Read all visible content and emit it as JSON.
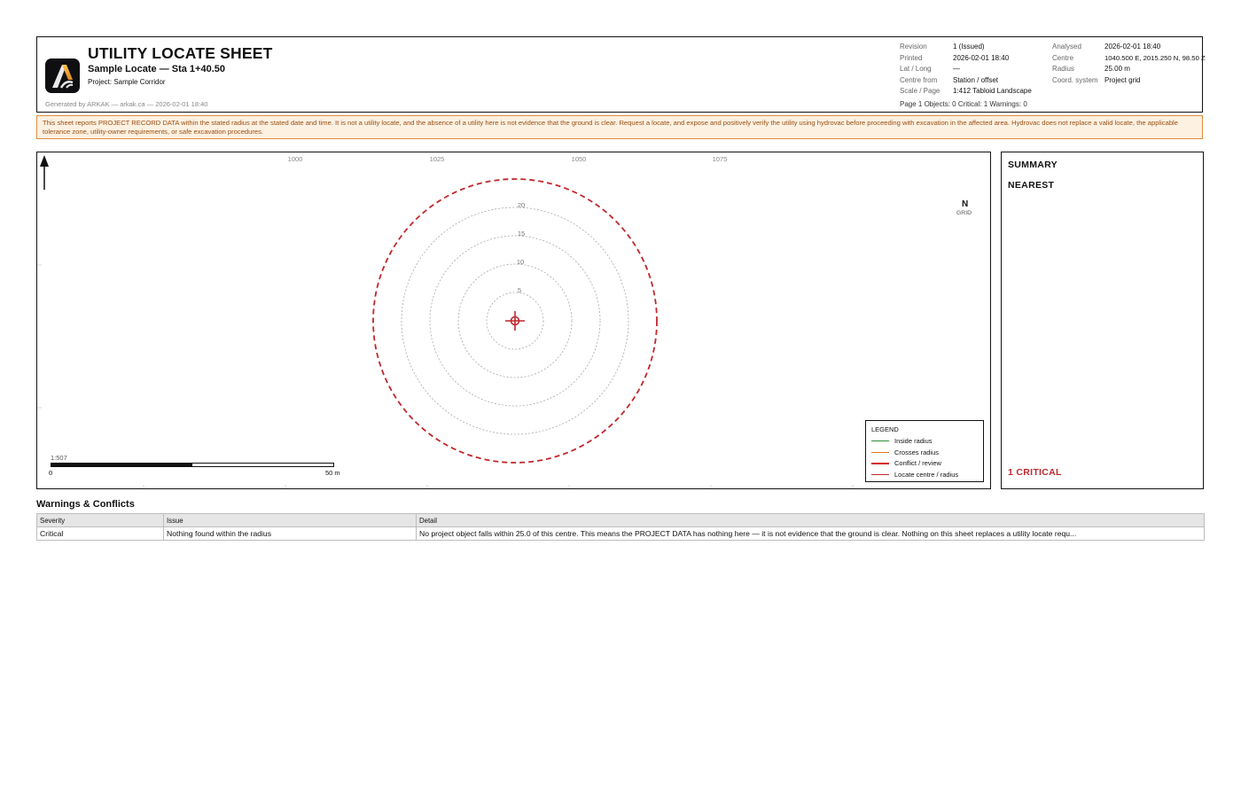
{
  "header": {
    "title": "UTILITY LOCATE SHEET",
    "subtitle": "Sample Locate — Sta 1+40.50",
    "project": "Project: Sample Corridor",
    "generated": "Generated by ARKAK — arkak.ca — 2026-02-01 18:40",
    "logo_icon": "arkak-logo-icon",
    "meta_left": [
      {
        "key": "Revision",
        "value": "1  (Issued)"
      },
      {
        "key": "Printed",
        "value": "2026-02-01 18:40"
      },
      {
        "key": "Lat / Long",
        "value": "—"
      },
      {
        "key": "Centre from",
        "value": "Station / offset"
      },
      {
        "key": "Scale / Page",
        "value": "1:412  Tabloid Landscape"
      }
    ],
    "meta_right": [
      {
        "key": "Analysed",
        "value": "2026-02-01 18:40"
      },
      {
        "key": "Centre",
        "value": "1040.500 E, 2015.250 N, 98.50 Z"
      },
      {
        "key": "Radius",
        "value": "25.00 m"
      },
      {
        "key": "Coord. system",
        "value": "Project grid"
      }
    ],
    "counts": "Page 1    Objects: 0    Critical: 1    Warnings: 0"
  },
  "disclaimer": "This sheet reports PROJECT RECORD DATA within the stated radius at the stated date and time. It is not a utility locate, and the absence of a utility here is not evidence that the ground is clear. Request a locate, and expose and positively verify the utility using hydrovac before proceeding with excavation in the affected area. Hydrovac does not replace a valid locate, the applicable tolerance zone, utility-owner requirements, or safe excavation procedures.",
  "map": {
    "grid_labels": [
      "1000",
      "1025",
      "1050",
      "1075"
    ],
    "ring_labels": [
      "5",
      "10",
      "15",
      "20"
    ],
    "north_label": "N",
    "north_sub": "GRID",
    "north_icon": "north-arrow-icon",
    "centre_icon": "crosshair-icon",
    "scale_ratio": "1:507",
    "scale_start": "0",
    "scale_end": "50 m",
    "legend": {
      "title": "LEGEND",
      "items": [
        {
          "label": "Inside radius",
          "color": "#2e8b3a"
        },
        {
          "label": "Crosses radius",
          "color": "#e07a1f"
        },
        {
          "label": "Conflict / review",
          "color": "#d42020"
        },
        {
          "label": "Locate centre / radius",
          "color": "#c0272d"
        }
      ]
    }
  },
  "summary": {
    "heading": "SUMMARY",
    "nearest_heading": "NEAREST",
    "critical": "1 CRITICAL"
  },
  "warnings": {
    "title": "Warnings & Conflicts",
    "columns": [
      "Severity",
      "Issue",
      "Detail"
    ],
    "rows": [
      {
        "severity": "Critical",
        "issue": "Nothing found within the radius",
        "detail": "No project object falls within 25.0 of this centre. This means the PROJECT DATA has nothing here — it is not evidence that the ground is clear. Nothing on this sheet replaces a utility locate requ..."
      }
    ]
  },
  "colors": {
    "critical": "#c0272d",
    "warning_bg": "#fdf1e2",
    "warning_border": "#e08b3a",
    "warning_text": "#9a4f12"
  }
}
